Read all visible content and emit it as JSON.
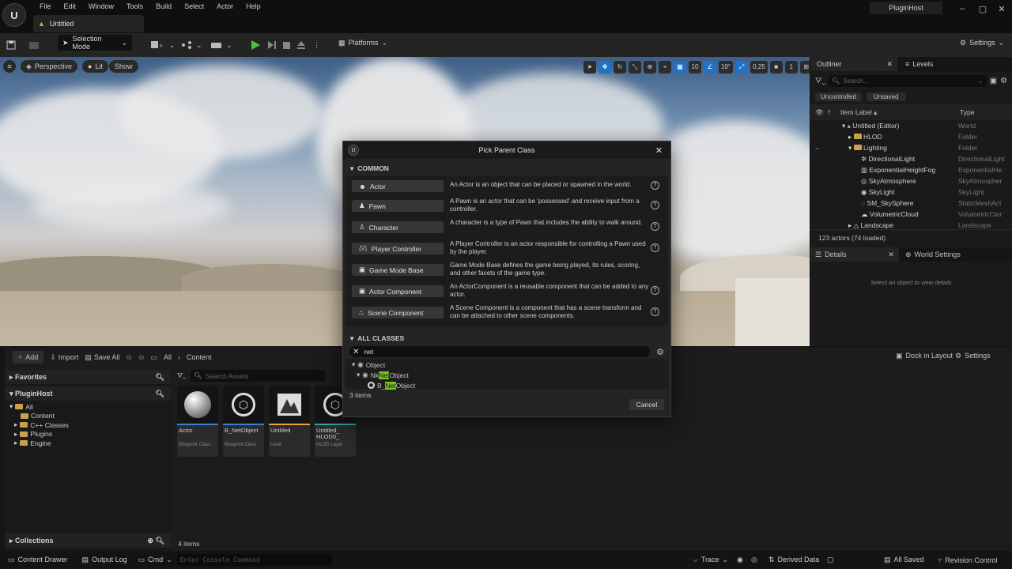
{
  "menu": [
    "File",
    "Edit",
    "Window",
    "Tools",
    "Build",
    "Select",
    "Actor",
    "Help"
  ],
  "tab_title": "Untitled",
  "project_name": "PluginHost",
  "toolbar": {
    "selection_mode": "Selection Mode",
    "platforms": "Platforms",
    "settings": "Settings"
  },
  "viewport": {
    "perspective": "Perspective",
    "lit": "Lit",
    "show": "Show",
    "grid_snap": "10",
    "rot_snap": "10°",
    "scale_snap": "0,25",
    "camera_speed": "1"
  },
  "outliner": {
    "tab": "Outliner",
    "levels_tab": "Levels",
    "search_placeholder": "Search...",
    "filter_uncontrolled": "Uncontrolled",
    "filter_unsaved": "Unsaved",
    "col_label": "Item Label ▴",
    "col_type": "Type",
    "rows": [
      {
        "label": "Untitled (Editor)",
        "type": "World"
      },
      {
        "label": "HLOD",
        "type": "Folder"
      },
      {
        "label": "Lighting",
        "type": "Folder"
      },
      {
        "label": "DirectionalLight",
        "type": "DirectionalLight"
      },
      {
        "label": "ExponentialHeightFog",
        "type": "ExponentialHe"
      },
      {
        "label": "SkyAtmosphere",
        "type": "SkyAtmospher"
      },
      {
        "label": "SkyLight",
        "type": "SkyLight"
      },
      {
        "label": "SM_SkySphere",
        "type": "StaticMeshAct"
      },
      {
        "label": "VolumetricCloud",
        "type": "VolumetricClor"
      },
      {
        "label": "Landscape",
        "type": "Landscape"
      }
    ],
    "count": "123 actors (74 loaded)"
  },
  "details": {
    "tab": "Details",
    "world_settings_tab": "World Settings",
    "empty": "Select an object to view details"
  },
  "content": {
    "add": "Add",
    "import": "Import",
    "save_all": "Save All",
    "crumb_all": "All",
    "crumb_content": "Content",
    "dock": "Dock in Layout",
    "settings": "Settings",
    "favorites": "Favorites",
    "project": "PluginHost",
    "tree": [
      "All",
      "Content",
      "C++ Classes",
      "Plugins",
      "Engine"
    ],
    "collections": "Collections",
    "search_placeholder": "Search Assets",
    "assets": [
      {
        "name": "Actor",
        "type": "Blueprint Class"
      },
      {
        "name": "B_NetObject",
        "type": "Blueprint Class"
      },
      {
        "name": "Untitled",
        "type": "Level"
      },
      {
        "name": "Untitled_ HLOD0_",
        "type": "HLOD Layer"
      }
    ],
    "count": "4 items"
  },
  "status": {
    "drawer": "Content Drawer",
    "output": "Output Log",
    "cmd": "Cmd",
    "console_placeholder": "Enter Console Command",
    "trace": "Trace",
    "derived": "Derived Data",
    "saved": "All Saved",
    "revision": "Revision Control"
  },
  "dialog": {
    "title": "Pick Parent Class",
    "common": "COMMON",
    "classes": [
      {
        "name": "Actor",
        "desc": "An Actor is an object that can be placed or spawned in the world."
      },
      {
        "name": "Pawn",
        "desc": "A Pawn is an actor that can be 'possessed' and receive input from a controller."
      },
      {
        "name": "Character",
        "desc": "A character is a type of Pawn that includes the ability to walk around."
      },
      {
        "name": "Player Controller",
        "desc": "A Player Controller is an actor responsible for controlling a Pawn used by the player."
      },
      {
        "name": "Game Mode Base",
        "desc": "Game Mode Base defines the game being played, its rules, scoring, and other facets of the game type."
      },
      {
        "name": "Actor Component",
        "desc": "An ActorComponent is a reusable component that can be added to any actor."
      },
      {
        "name": "Scene Component",
        "desc": "A Scene Component is a component that has a scene transform and can be attached to other scene components."
      }
    ],
    "all_classes": "ALL CLASSES",
    "search_value": "net",
    "tree": {
      "root": "Object",
      "n1_pre": "Nk",
      "n1_hl": "Net",
      "n1_post": "Object",
      "n2_pre": "B_",
      "n2_hl": "Net",
      "n2_post": "Object"
    },
    "count": "3 items",
    "cancel": "Cancel"
  }
}
